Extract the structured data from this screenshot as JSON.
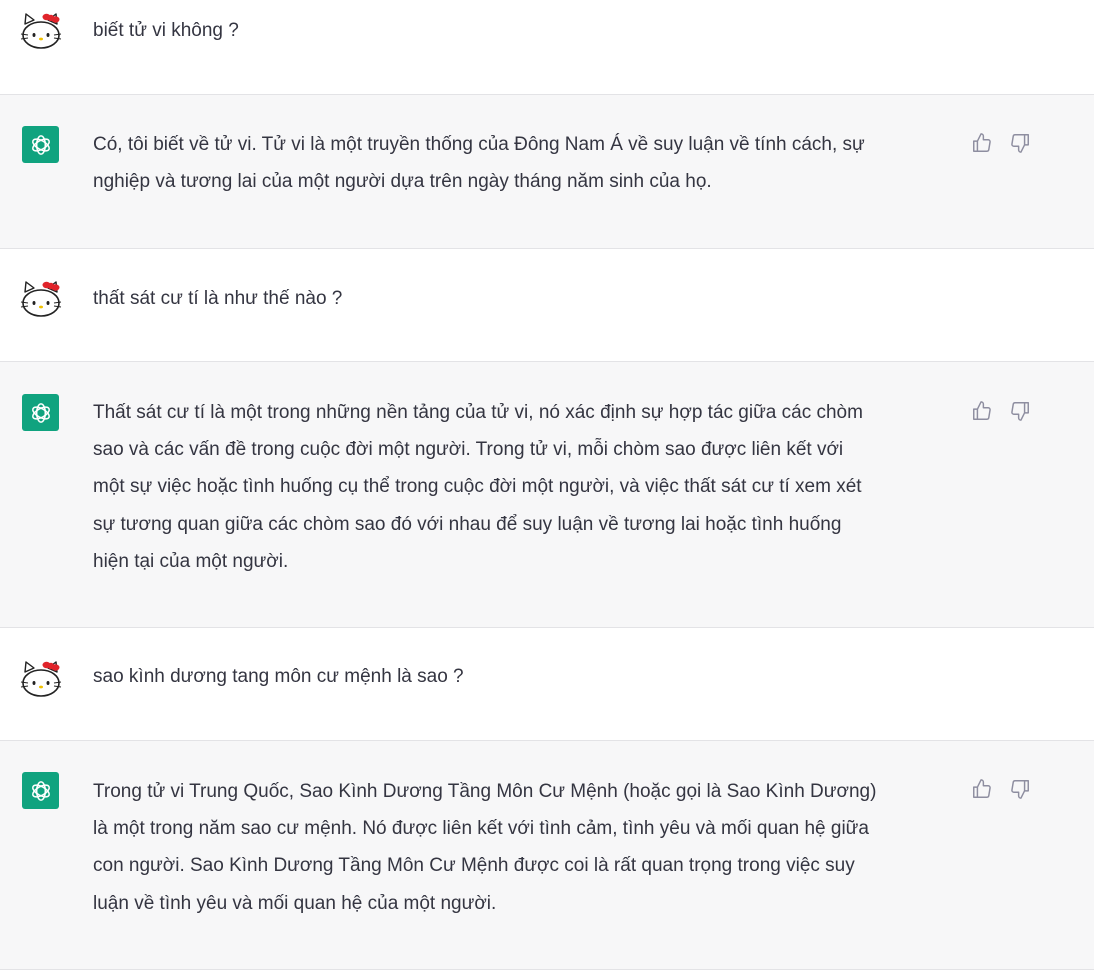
{
  "messages": [
    {
      "role": "user",
      "avatar_icon": "hello-kitty-avatar-icon",
      "text": "biết tử vi không ?"
    },
    {
      "role": "assistant",
      "avatar_icon": "openai-logo-icon",
      "text": "Có, tôi biết về tử vi. Tử vi là một truyền thống của Đông Nam Á về suy luận về tính cách, sự\nnghiệp và tương lai của một người dựa trên ngày tháng năm sinh của họ."
    },
    {
      "role": "user",
      "avatar_icon": "hello-kitty-avatar-icon",
      "text": "thất sát cư tí là như thế nào ?"
    },
    {
      "role": "assistant",
      "avatar_icon": "openai-logo-icon",
      "text": "Thất sát cư tí là một trong những nền tảng của tử vi, nó xác định sự hợp tác giữa các chòm\nsao và các vấn đề trong cuộc đời một người. Trong tử vi, mỗi chòm sao được liên kết với\nmột sự việc hoặc tình huống cụ thể trong cuộc đời một người, và việc thất sát cư tí xem xét\nsự tương quan giữa các chòm sao đó với nhau để suy luận về tương lai hoặc tình huống\nhiện tại của một người."
    },
    {
      "role": "user",
      "avatar_icon": "hello-kitty-avatar-icon",
      "text": "sao kình dương tang môn cư mệnh là sao ?"
    },
    {
      "role": "assistant",
      "avatar_icon": "openai-logo-icon",
      "text": "Trong tử vi Trung Quốc, Sao Kình Dương Tầng Môn Cư Mệnh (hoặc gọi là Sao Kình Dương)\nlà một trong năm sao cư mệnh. Nó được liên kết với tình cảm, tình yêu và mối quan hệ giữa\ncon người. Sao Kình Dương Tầng Môn Cư Mệnh được coi là rất quan trọng trong việc suy\nluận về tình yêu và mối quan hệ của một người."
    }
  ],
  "feedback_icons": [
    "thumbs-up-icon",
    "thumbs-down-icon"
  ],
  "colors": {
    "assistant_bg": "#f7f7f8",
    "user_bg": "#ffffff",
    "brand_green": "#10a37f",
    "text": "#343541",
    "icon_gray": "#8e8ea0"
  }
}
